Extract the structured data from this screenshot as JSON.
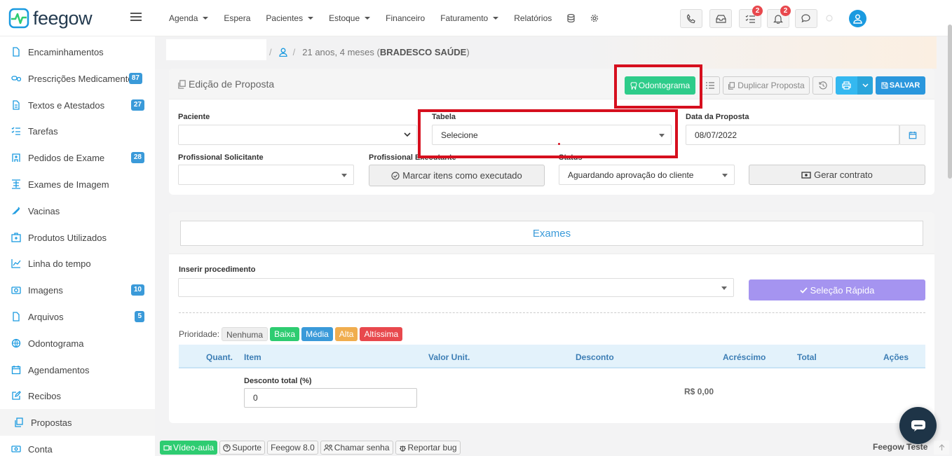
{
  "brand": {
    "name": "feegow",
    "color": "#1a9ae0"
  },
  "nav": {
    "items": [
      {
        "label": "Agenda",
        "dropdown": true
      },
      {
        "label": "Espera",
        "dropdown": false
      },
      {
        "label": "Pacientes",
        "dropdown": true
      },
      {
        "label": "Estoque",
        "dropdown": true
      },
      {
        "label": "Financeiro",
        "dropdown": false
      },
      {
        "label": "Faturamento",
        "dropdown": true
      },
      {
        "label": "Relatórios",
        "dropdown": false
      }
    ]
  },
  "topbar": {
    "tasks_badge": "2",
    "notifications_badge": "2"
  },
  "sidebar": {
    "items": [
      {
        "label": "Encaminhamentos",
        "icon": "file-icon",
        "badge": ""
      },
      {
        "label": "Prescrições Medicamentos",
        "icon": "pills-icon",
        "badge": "87"
      },
      {
        "label": "Textos e Atestados",
        "icon": "document-icon",
        "badge": "27"
      },
      {
        "label": "Tarefas",
        "icon": "tasks-icon",
        "badge": ""
      },
      {
        "label": "Pedidos de Exame",
        "icon": "hospital-icon",
        "badge": "28"
      },
      {
        "label": "Exames de Imagem",
        "icon": "xray-icon",
        "badge": ""
      },
      {
        "label": "Vacinas",
        "icon": "syringe-icon",
        "badge": ""
      },
      {
        "label": "Produtos Utilizados",
        "icon": "box-icon",
        "badge": ""
      },
      {
        "label": "Linha do tempo",
        "icon": "chart-line-icon",
        "badge": ""
      },
      {
        "label": "Imagens",
        "icon": "camera-icon",
        "badge": "10"
      },
      {
        "label": "Arquivos",
        "icon": "file-icon",
        "badge": "5"
      },
      {
        "label": "Odontograma",
        "icon": "globe-icon",
        "badge": ""
      },
      {
        "label": "Agendamentos",
        "icon": "calendar-icon",
        "badge": ""
      },
      {
        "label": "Recibos",
        "icon": "edit-icon",
        "badge": ""
      },
      {
        "label": "Propostas",
        "icon": "copy-icon",
        "badge": "",
        "active": true
      },
      {
        "label": "Conta",
        "icon": "money-icon",
        "badge": ""
      }
    ]
  },
  "breadcrumb": {
    "prefix": "21 anos, 4 meses (",
    "insurance": "BRADESCO SAÚDE",
    "suffix": ")"
  },
  "proposal": {
    "title": "Edição de Proposta",
    "buttons": {
      "odontograma": "Odontograma",
      "duplicar": "Duplicar Proposta",
      "salvar": "SALVAR"
    },
    "fields": {
      "paciente_label": "Paciente",
      "tabela_label": "Tabela",
      "tabela_value": "Selecione",
      "data_label": "Data da Proposta",
      "data_value": "08/07/2022",
      "prof_sol_label": "Profissional Solicitante",
      "prof_exec_label": "Profissional Executante",
      "marcar_label": "Marcar itens como executado",
      "status_label": "Status",
      "status_value": "Aguardando aprovação do cliente",
      "gerar_label": "Gerar contrato"
    }
  },
  "exames": {
    "tab_label": "Exames",
    "inserir_label": "Inserir procedimento",
    "selecao_label": "Seleção Rápida",
    "prioridade_label": "Prioridade:",
    "priorities": [
      {
        "label": "Nenhuma",
        "bg": "#eeeeee",
        "fg": "#555555"
      },
      {
        "label": "Baixa",
        "bg": "#2ecc71",
        "fg": "#ffffff"
      },
      {
        "label": "Média",
        "bg": "#3a9ad9",
        "fg": "#ffffff"
      },
      {
        "label": "Alta",
        "bg": "#f0ad4e",
        "fg": "#ffffff"
      },
      {
        "label": "Altíssima",
        "bg": "#e8484d",
        "fg": "#ffffff"
      }
    ],
    "columns": [
      "Quant.",
      "Item",
      "Valor Unit.",
      "Desconto",
      "Acréscimo",
      "Total",
      "Ações"
    ],
    "desconto_total_label": "Desconto total (%)",
    "desconto_total_value": "0",
    "total_value": "R$ 0,00"
  },
  "footer": {
    "video": "Vídeo-aula",
    "suporte": "Suporte",
    "version": "Feegow 8.0",
    "chamar": "Chamar senha",
    "reportar": "Reportar bug",
    "user": "Feegow Teste"
  }
}
